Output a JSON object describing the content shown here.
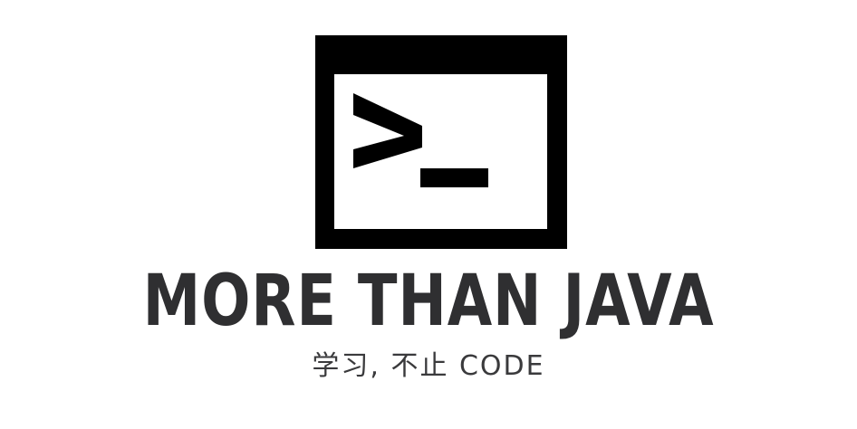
{
  "logo": {
    "icon": "terminal-icon",
    "title": "MORE THAN JAVA",
    "tagline": "学习, 不止 CODE",
    "colors": {
      "icon": "#000000",
      "title": "#2f2f31",
      "tagline": "#3a3a3c",
      "background": "#ffffff"
    }
  }
}
